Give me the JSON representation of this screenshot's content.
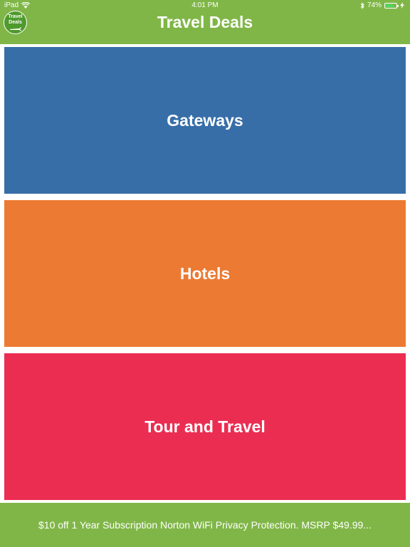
{
  "status_bar": {
    "device": "iPad",
    "time": "4:01 PM",
    "battery": "74%",
    "battery_level": 0.74
  },
  "header": {
    "logo_line1": "Travel",
    "logo_line2": "Deals",
    "title": "Travel Deals"
  },
  "tiles": [
    {
      "label": "Gateways",
      "color": "#376ea8"
    },
    {
      "label": "Hotels",
      "color": "#ec7a32"
    },
    {
      "label": "Tour and Travel",
      "color": "#ec2d52"
    }
  ],
  "ad": {
    "text": "$10 off 1 Year Subscription Norton WiFi Privacy Protection. MSRP $49.99..."
  },
  "icons": [
    "wifi-icon",
    "bluetooth-icon",
    "battery-icon",
    "charging-icon",
    "airplane-icon"
  ],
  "colors": {
    "header_green": "#80b647",
    "battery_green": "#4cd964"
  }
}
